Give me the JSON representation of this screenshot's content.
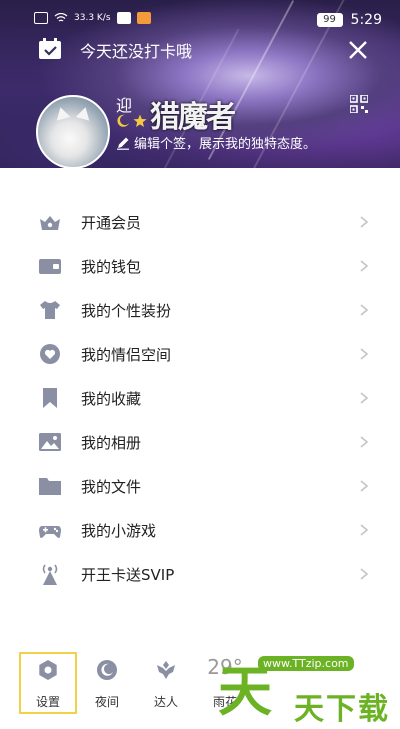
{
  "status_bar": {
    "network_speed": "33.3 K/s",
    "battery": "99",
    "time": "5:29"
  },
  "header": {
    "checkin_text": "今天还没打卡哦",
    "username": "迎",
    "logo_text": "猎魔者",
    "signature": "编辑个签，展示我的独特态度。"
  },
  "menu": {
    "items": [
      {
        "label": "开通会员",
        "icon": "vip-crown-icon"
      },
      {
        "label": "我的钱包",
        "icon": "wallet-icon"
      },
      {
        "label": "我的个性装扮",
        "icon": "shirt-icon"
      },
      {
        "label": "我的情侣空间",
        "icon": "couple-heart-icon"
      },
      {
        "label": "我的收藏",
        "icon": "bookmark-icon"
      },
      {
        "label": "我的相册",
        "icon": "photo-album-icon"
      },
      {
        "label": "我的文件",
        "icon": "folder-icon"
      },
      {
        "label": "我的小游戏",
        "icon": "gamepad-icon"
      },
      {
        "label": "开王卡送SVIP",
        "icon": "signal-tower-icon"
      }
    ]
  },
  "bottom_bar": {
    "items": [
      {
        "label": "设置",
        "icon": "settings-icon",
        "selected": true
      },
      {
        "label": "夜间",
        "icon": "moon-icon"
      },
      {
        "label": "达人",
        "icon": "expert-badge-icon"
      },
      {
        "label": "雨花",
        "icon": "weather",
        "temperature": "29°"
      }
    ]
  },
  "watermark": {
    "site": "www.TTzip.com",
    "big": "天",
    "small": "天下载"
  },
  "colors": {
    "icon_gray": "#8a8fa3",
    "chevron": "#c4c4c4",
    "watermark_green": "#6bb324",
    "selected_outline": "#f2d14a"
  }
}
